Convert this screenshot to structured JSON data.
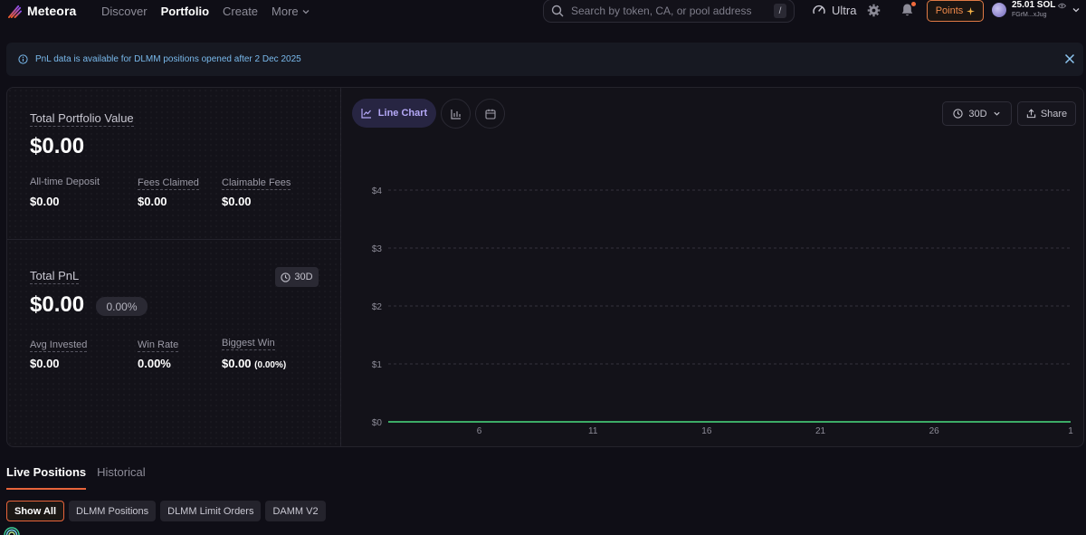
{
  "nav": {
    "brand": "Meteora",
    "links": [
      {
        "label": "Discover",
        "active": false
      },
      {
        "label": "Portfolio",
        "active": true
      },
      {
        "label": "Create",
        "active": false
      },
      {
        "label": "More",
        "active": false
      }
    ],
    "search_placeholder": "Search by token, CA, or pool address",
    "search_shortcut": "/",
    "ultra_label": "Ultra",
    "points_label": "Points",
    "wallet_balance": "25.01 SOL",
    "wallet_address": "FGrM...xJug"
  },
  "banner": {
    "text": "PnL data is available for DLMM positions opened after 2 Dec 2025"
  },
  "summary": {
    "portfolio_title": "Total Portfolio Value",
    "portfolio_value": "$0.00",
    "deposit_label": "All-time Deposit",
    "deposit_value": "$0.00",
    "fees_claimed_label": "Fees Claimed",
    "fees_claimed_value": "$0.00",
    "claimable_label": "Claimable Fees",
    "claimable_value": "$0.00",
    "pnl_title": "Total PnL",
    "pnl_period": "30D",
    "pnl_value": "$0.00",
    "pnl_percent": "0.00%",
    "avg_invested_label": "Avg Invested",
    "avg_invested_value": "$0.00",
    "win_rate_label": "Win Rate",
    "win_rate_value": "0.00%",
    "biggest_win_label": "Biggest Win",
    "biggest_win_value": "$0.00",
    "biggest_win_pct": "(0.00%)"
  },
  "chart_controls": {
    "line_chart_label": "Line Chart",
    "period_label": "30D",
    "share_label": "Share"
  },
  "chart_data": {
    "type": "line",
    "x": [
      2,
      3,
      4,
      5,
      6,
      7,
      8,
      9,
      10,
      11,
      12,
      13,
      14,
      15,
      16,
      17,
      18,
      19,
      20,
      21,
      22,
      23,
      24,
      25,
      26,
      27,
      28,
      29,
      30,
      31,
      32
    ],
    "x_tick_values": [
      6,
      11,
      16,
      21,
      26,
      32
    ],
    "x_tick_labels": [
      "6",
      "11",
      "16",
      "21",
      "26",
      "1"
    ],
    "series": [
      {
        "values": [
          0,
          0,
          0,
          0,
          0,
          0,
          0,
          0,
          0,
          0,
          0,
          0,
          0,
          0,
          0,
          0,
          0,
          0,
          0,
          0,
          0,
          0,
          0,
          0,
          0,
          0,
          0,
          0,
          0,
          0,
          0
        ],
        "color": "#4ade80"
      }
    ],
    "y_ticks": [
      "$0",
      "$1",
      "$2",
      "$3",
      "$4"
    ],
    "ylim": [
      0,
      4
    ],
    "xlim": [
      2,
      32
    ],
    "grid": true
  },
  "positions": {
    "tabs": [
      {
        "label": "Live Positions",
        "active": true
      },
      {
        "label": "Historical",
        "active": false
      }
    ],
    "filters": [
      {
        "label": "Show All",
        "active": true
      },
      {
        "label": "DLMM Positions",
        "active": false
      },
      {
        "label": "DLMM Limit Orders",
        "active": false
      },
      {
        "label": "DAMM V2",
        "active": false
      }
    ]
  },
  "colors": {
    "accent_orange": "#e8643a",
    "accent_purple": "#b4a8f6",
    "chart_line": "#4ade80",
    "info_blue": "#79b9ec"
  }
}
